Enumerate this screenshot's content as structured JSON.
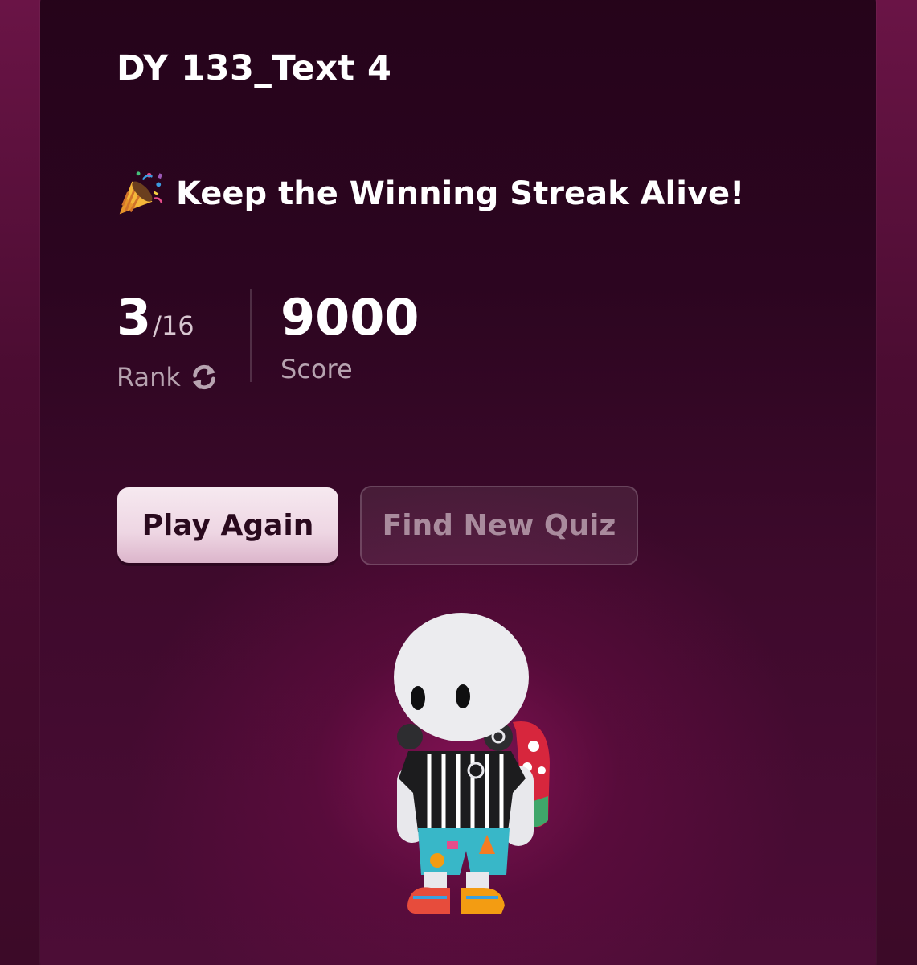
{
  "quiz": {
    "title": "DY 133_Text 4",
    "message": "Keep the Winning Streak Alive!",
    "message_icon": "party-popper-icon"
  },
  "stats": {
    "rank": {
      "value": "3",
      "total": "/16",
      "label": "Rank",
      "icon": "refresh-icon"
    },
    "score": {
      "value": "9000",
      "label": "Score"
    }
  },
  "actions": {
    "play_again_label": "Play Again",
    "find_new_quiz_label": "Find New Quiz"
  },
  "colors": {
    "background": "#2a061d",
    "primary_button": "#f2e1ea",
    "secondary_button_text": "#a98b9d",
    "label_text": "#b7a3b0"
  }
}
